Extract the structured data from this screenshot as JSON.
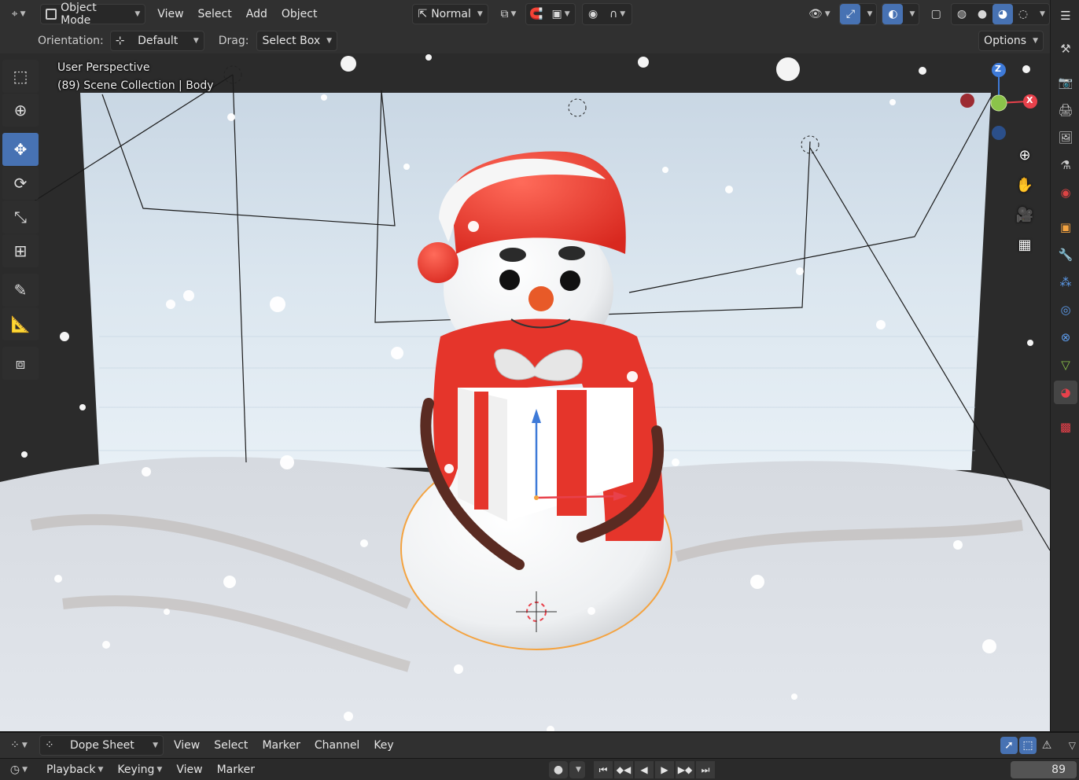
{
  "header": {
    "mode": "Object Mode",
    "menu": [
      "View",
      "Select",
      "Add",
      "Object"
    ],
    "transform_orientation_global": "Normal",
    "options_label": "Options"
  },
  "tool_settings": {
    "orientation_label": "Orientation:",
    "orientation_value": "Default",
    "drag_label": "Drag:",
    "drag_value": "Select Box"
  },
  "viewport": {
    "perspective_label": "User Perspective",
    "collection_label": "(89) Scene Collection | Body",
    "gizmo_axes": {
      "z": "Z",
      "x": "X"
    }
  },
  "tools": [
    {
      "name": "select-box-tool",
      "icon": "select-box-icon",
      "active": false
    },
    {
      "name": "cursor-tool",
      "icon": "cursor-icon",
      "active": false
    },
    {
      "name": "move-tool",
      "icon": "move-icon",
      "active": true
    },
    {
      "name": "rotate-tool",
      "icon": "rotate-icon",
      "active": false
    },
    {
      "name": "scale-tool",
      "icon": "scale-icon",
      "active": false
    },
    {
      "name": "transform-tool",
      "icon": "transform-icon",
      "active": false
    },
    {
      "name": "annotate-tool",
      "icon": "annotate-icon",
      "active": false
    },
    {
      "name": "measure-tool",
      "icon": "measure-icon",
      "active": false
    },
    {
      "name": "add-cube-tool",
      "icon": "add-cube-icon",
      "active": false
    }
  ],
  "dope_sheet": {
    "editor": "Dope Sheet",
    "menu": [
      "View",
      "Select",
      "Marker",
      "Channel",
      "Key"
    ]
  },
  "timeline": {
    "menu": [
      "Playback",
      "Keying",
      "View",
      "Marker"
    ],
    "current_frame": "89"
  },
  "colors": {
    "accent": "#4772b3",
    "axis_x": "#e8414b",
    "axis_y": "#8bc34a",
    "axis_z": "#3e7ad8",
    "selection_outline": "#f4a340"
  }
}
